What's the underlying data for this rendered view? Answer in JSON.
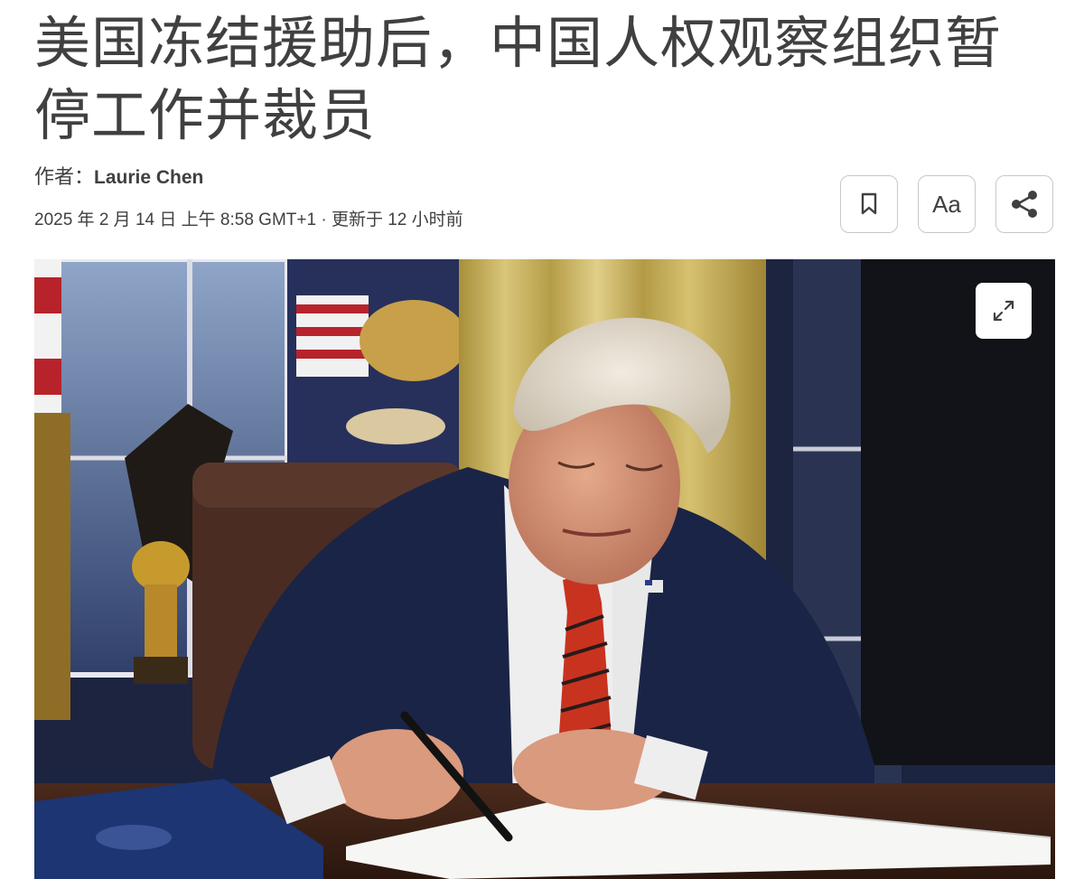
{
  "article": {
    "headline": "美国冻结援助后，中国人权观察组织暂停工作并裁员",
    "byline_prefix": "作者：",
    "author": "Laurie Chen",
    "dateline": "2025 年 2 月 14 日 上午 8:58 GMT+1 · 更新于 12 小时前"
  },
  "toolbar": {
    "bookmark_icon": "bookmark-icon",
    "font_size_label": "Aa",
    "share_icon": "share-icon"
  },
  "photo": {
    "expand_icon": "expand-icon"
  },
  "colors": {
    "text": "#404040",
    "button_border": "#c8c8c8"
  }
}
